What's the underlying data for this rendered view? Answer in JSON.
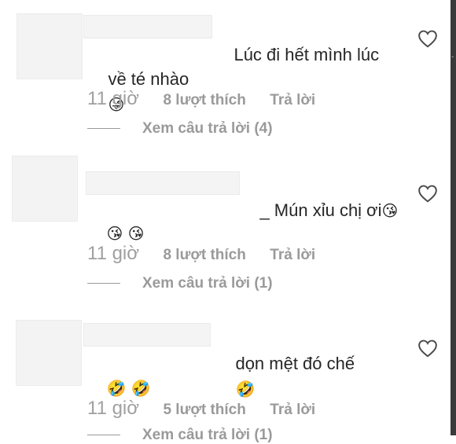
{
  "comments": [
    {
      "text_line1": "Lúc đi hết mình lúc",
      "text_line2": "về té nhào",
      "emoji_line2": "😜",
      "time": "11 giờ",
      "likes": "8 lượt thích",
      "reply": "Trả lời",
      "view_replies": "Xem câu trả lời (4)"
    },
    {
      "text_line1": "_ Mún xỉu chị ơi",
      "emoji_line1": "😘",
      "emoji_line2": "😘 😘",
      "time": "11 giờ",
      "likes": "8 lượt thích",
      "reply": "Trả lời",
      "view_replies": "Xem câu trả lời (1)"
    },
    {
      "text_line1": "dọn mệt đó chế",
      "emoji_line1": "🤣",
      "emoji_line2": "🤣 🤣",
      "time": "11 giờ",
      "likes": "5 lượt thích",
      "reply": "Trả lời",
      "view_replies": "Xem câu trả lời (1)"
    }
  ],
  "icons": {
    "like": "heart-outline-icon"
  },
  "colors": {
    "text": "#262626",
    "meta": "#9a9a9a",
    "background": "#ffffff"
  }
}
